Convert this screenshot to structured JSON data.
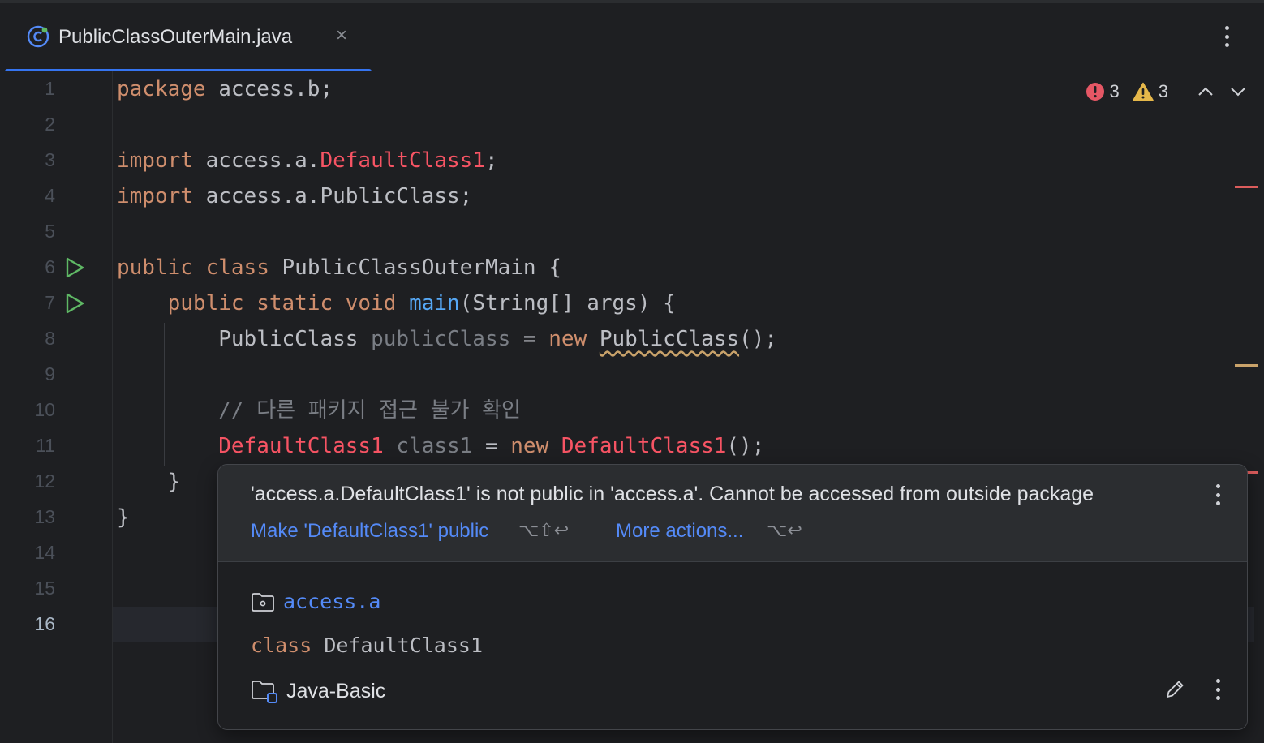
{
  "tab": {
    "title": "PublicClassOuterMain.java",
    "close": "×"
  },
  "editor": {
    "line_numbers": [
      "1",
      "2",
      "3",
      "4",
      "5",
      "6",
      "7",
      "8",
      "9",
      "10",
      "11",
      "12",
      "13",
      "14",
      "15",
      "16"
    ],
    "inspection": {
      "errors": "3",
      "warnings": "3"
    },
    "code": {
      "l1": {
        "kw": "package",
        "rest": " access.b;"
      },
      "l3": {
        "kw": "import",
        "pre": " access.a.",
        "err": "DefaultClass1",
        "post": ";"
      },
      "l4": {
        "kw": "import",
        "rest": " access.a.PublicClass;"
      },
      "l6": {
        "kw1": "public",
        "kw2": "class",
        "rest": " PublicClassOuterMain {"
      },
      "l7": {
        "kw1": "public",
        "kw2": "static",
        "kw3": "void",
        "fn": "main",
        "rest": "(String[] args) {"
      },
      "l8": {
        "type": "PublicClass",
        "var": "publicClass",
        "eq": " = ",
        "kw": "new",
        "ctor": "PublicClass",
        "post": "();"
      },
      "l10": {
        "comment": "// 다른 패키지 접근 불가 확인"
      },
      "l11": {
        "type": "DefaultClass1",
        "var": "class1",
        "eq": " = ",
        "kw": "new",
        "ctor": "DefaultClass1",
        "post": "();"
      },
      "l12": {
        "text": "}"
      },
      "l13": {
        "text": "}"
      }
    }
  },
  "popup": {
    "message": "'access.a.DefaultClass1' is not public in 'access.a'. Cannot be accessed from outside package",
    "fix_label": "Make 'DefaultClass1' public",
    "fix_shortcut": "⌥⇧↩",
    "more_label": "More actions...",
    "more_shortcut": "⌥↩",
    "package": "access.a",
    "class_kw": "class",
    "class_name": "DefaultClass1",
    "module": "Java-Basic"
  },
  "colors": {
    "accent": "#3574f0",
    "error": "#f75464",
    "warning": "#e5b74a",
    "keyword": "#cf8e6d",
    "function": "#56a8f5",
    "link": "#548af7"
  }
}
